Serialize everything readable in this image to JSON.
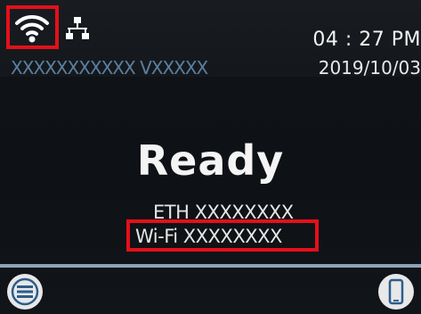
{
  "status_bar": {
    "wifi_icon": "wifi-icon",
    "ethernet_icon": "ethernet-icon",
    "time": "04 : 27 PM"
  },
  "info_bar": {
    "model": "XXXXXXXXXXX VXXXXX",
    "date": "2019/10/03"
  },
  "main": {
    "status": "Ready",
    "eth_line": "ETH XXXXXXXX",
    "wifi_line": "Wi-Fi XXXXXXXX"
  },
  "bottom_bar": {
    "menu_icon": "menu-icon",
    "mobile_icon": "mobile-device-icon"
  },
  "colors": {
    "highlight": "#e3101a",
    "model_text": "#5d7fa0",
    "divider": "#8da2b6"
  }
}
